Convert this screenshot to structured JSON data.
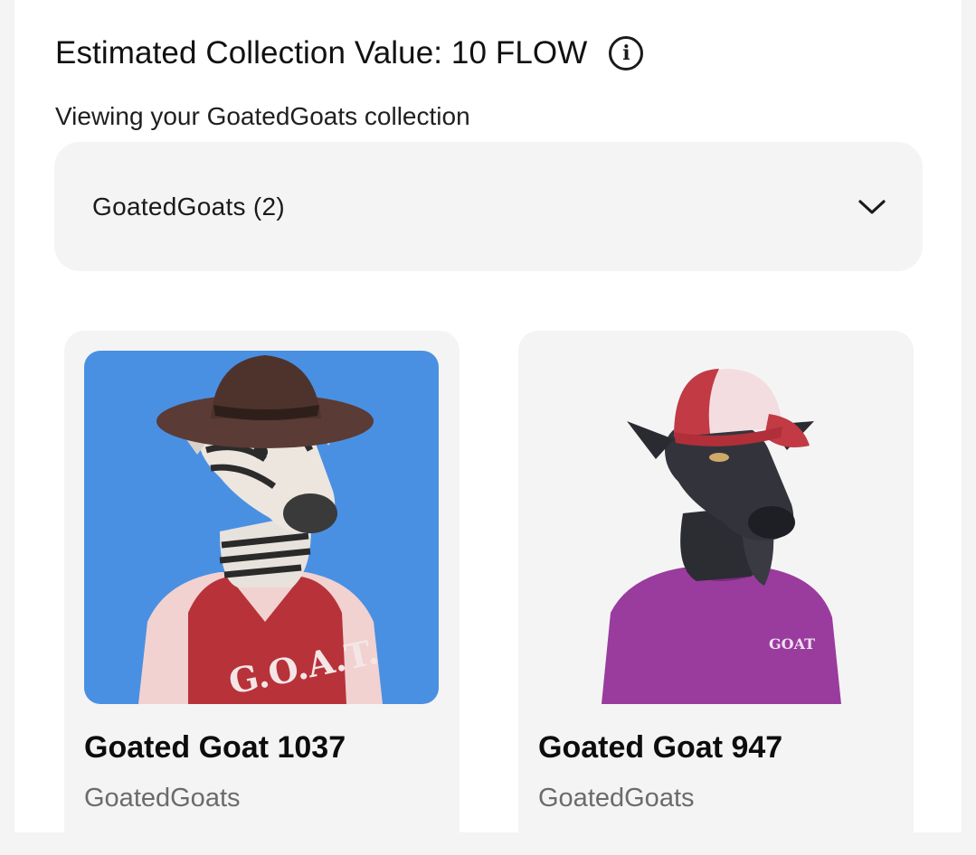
{
  "header": {
    "collection_value": "Estimated Collection Value: 10 FLOW",
    "info_icon": "info-icon"
  },
  "viewing_text": "Viewing your GoatedGoats collection",
  "dropdown": {
    "selected": "GoatedGoats (2)",
    "icon": "chevron-down-icon"
  },
  "nfts": [
    {
      "name": "Goated Goat 1037",
      "collection": "GoatedGoats",
      "background": "#4a90e2",
      "shirt_text": "G.O.A.T."
    },
    {
      "name": "Goated Goat 947",
      "collection": "GoatedGoats",
      "background": "#f4f4f4",
      "shirt_text": "GOAT"
    }
  ]
}
